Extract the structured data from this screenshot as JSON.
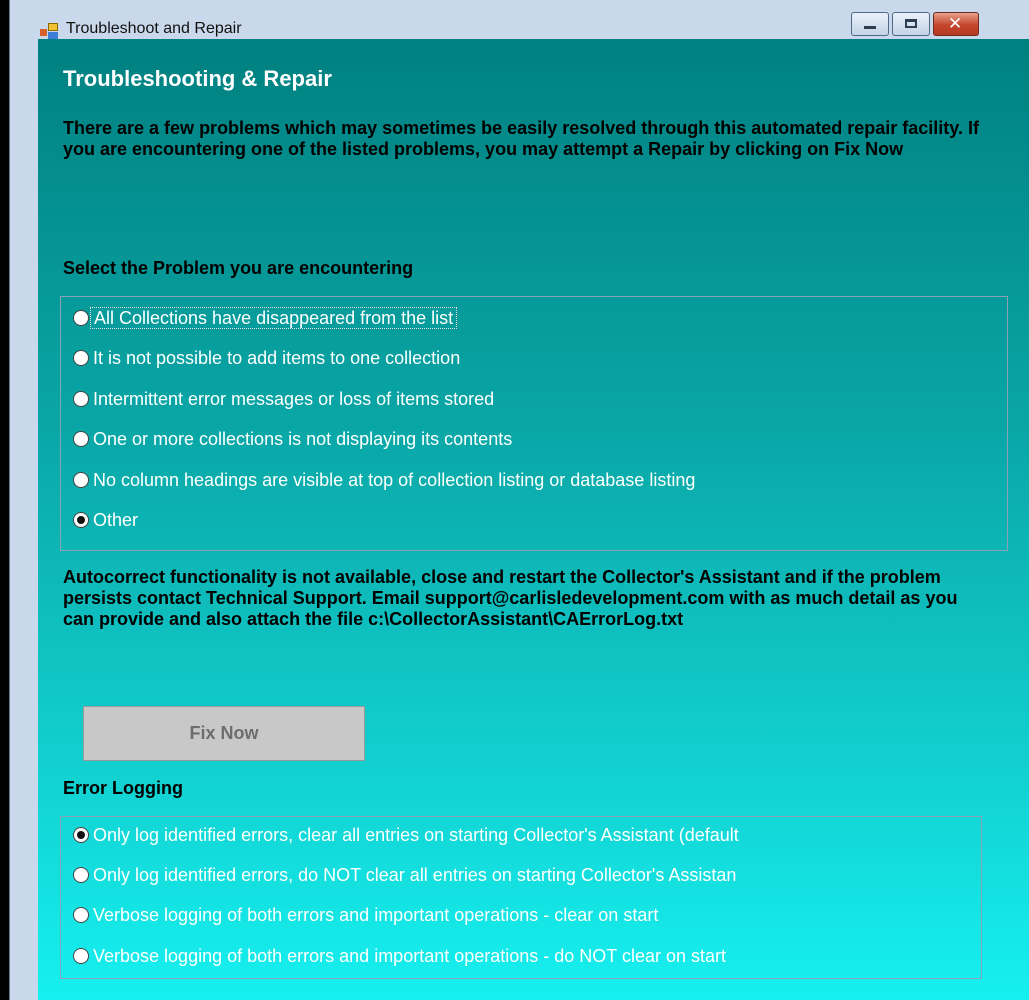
{
  "window": {
    "title": "Troubleshoot and Repair",
    "controls": {
      "minimize": "minimize",
      "maximize": "maximize",
      "close": "close"
    }
  },
  "content": {
    "heading": "Troubleshooting & Repair",
    "intro": "There are a few problems which may sometimes be easily resolved through this automated repair facility. If you are encountering one of the listed problems, you may attempt a Repair by clicking on Fix Now",
    "problem_label": "Select the Problem you are encountering",
    "problems": [
      {
        "label": "All Collections have disappeared from the list",
        "checked": false
      },
      {
        "label": "It is not possible to add items to one collection",
        "checked": false
      },
      {
        "label": "Intermittent error messages or loss of items stored",
        "checked": false
      },
      {
        "label": "One or more collections is not displaying its contents",
        "checked": false
      },
      {
        "label": "No column headings are visible at top of collection listing or database listing",
        "checked": false
      },
      {
        "label": "Other",
        "checked": true
      }
    ],
    "message": "Autocorrect functionality is not available, close and restart the Collector's Assistant and if the problem persists contact Technical Support. Email support@carlisledevelopment.com with as much detail as you can provide and also attach the file c:\\CollectorAssistant\\CAErrorLog.txt",
    "fix_button": "Fix Now",
    "logging_label": "Error Logging",
    "logging_options": [
      {
        "label": "Only log identified errors, clear all entries on starting Collector's Assistant (default",
        "checked": true
      },
      {
        "label": "Only log identified errors, do NOT clear all entries on starting Collector's Assistan",
        "checked": false
      },
      {
        "label": "Verbose logging of both errors and important operations - clear on start",
        "checked": false
      },
      {
        "label": "Verbose logging of both errors and important operations - do NOT clear on start",
        "checked": false
      }
    ]
  },
  "colors": {
    "accent_top": "#008080",
    "accent_bottom": "#16f0f0",
    "close_button": "#c3462d"
  }
}
